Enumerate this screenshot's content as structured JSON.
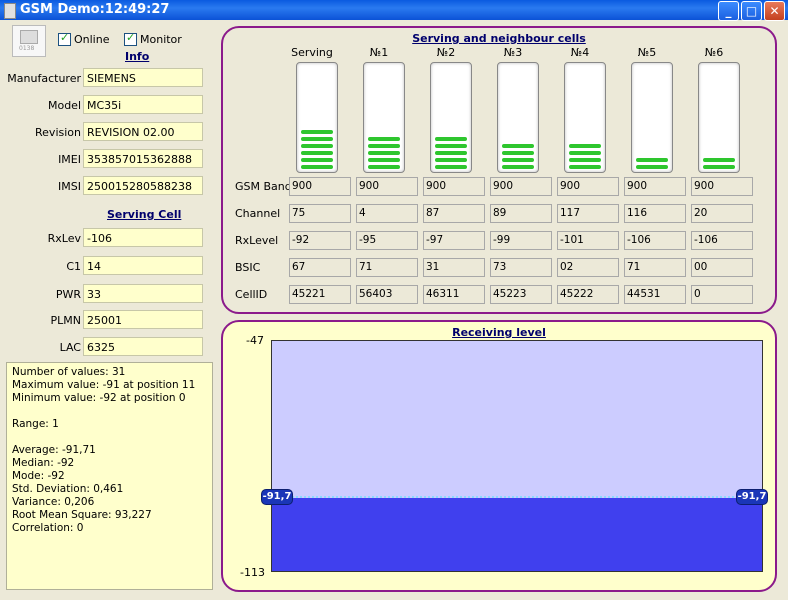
{
  "window": {
    "title": "GSM Demo:12:49:27"
  },
  "toolbar": {
    "online_label": "Online",
    "monitor_label": "Monitor",
    "online_checked": true,
    "monitor_checked": true,
    "app_icon_label": "0138"
  },
  "info": {
    "title": "Info",
    "manufacturer_label": "Manufacturer",
    "manufacturer": "SIEMENS",
    "model_label": "Model",
    "model": "MC35i",
    "revision_label": "Revision",
    "revision": "REVISION 02.00",
    "imei_label": "IMEI",
    "imei": "353857015362888",
    "imsi_label": "IMSI",
    "imsi": "250015280588238"
  },
  "serving_cell": {
    "title": "Serving Cell",
    "rxlev_label": "RxLev",
    "rxlev": "-106",
    "c1_label": "C1",
    "c1": " 14",
    "pwr_label": "PWR",
    "pwr": " 33",
    "plmn_label": "PLMN",
    "plmn": "25001",
    "lac_label": "LAC",
    "lac": "6325"
  },
  "stats": {
    "text": "Number of values: 31\nMaximum value: -91 at position 11\nMinimum value: -92 at position 0\n\nRange: 1\n\nAverage: -91,71\nMedian: -92\nMode: -92\nStd. Deviation: 0,461\nVariance: 0,206\nRoot Mean Square: 93,227\nCorrelation: 0"
  },
  "cells": {
    "title": "Serving and neighbour cells",
    "row_labels": {
      "band": "GSM Band",
      "channel": "Channel",
      "rxlevel": "RxLevel",
      "bsic": "BSIC",
      "cellid": "CellID"
    },
    "columns": [
      {
        "name": "Serving",
        "bars": 6,
        "band": "900",
        "channel": "75",
        "rxlevel": "-92",
        "bsic": "67",
        "cellid": "45221"
      },
      {
        "name": "№1",
        "bars": 5,
        "band": "900",
        "channel": "4",
        "rxlevel": "-95",
        "bsic": "71",
        "cellid": "56403"
      },
      {
        "name": "№2",
        "bars": 5,
        "band": "900",
        "channel": "87",
        "rxlevel": "-97",
        "bsic": "31",
        "cellid": "46311"
      },
      {
        "name": "№3",
        "bars": 4,
        "band": "900",
        "channel": "89",
        "rxlevel": "-99",
        "bsic": "73",
        "cellid": "45223"
      },
      {
        "name": "№4",
        "bars": 4,
        "band": "900",
        "channel": "117",
        "rxlevel": "-101",
        "bsic": "02",
        "cellid": "45222"
      },
      {
        "name": "№5",
        "bars": 2,
        "band": "900",
        "channel": "116",
        "rxlevel": "-106",
        "bsic": "71",
        "cellid": "44531"
      },
      {
        "name": "№6",
        "bars": 2,
        "band": "900",
        "channel": "20",
        "rxlevel": "-106",
        "bsic": "00",
        "cellid": "0"
      }
    ]
  },
  "receiving": {
    "title": "Receiving level",
    "y_max": "-47",
    "y_min": "-113",
    "current_left": "-91,7",
    "current_right": "-91,7"
  },
  "chart_data": {
    "type": "area",
    "title": "Receiving level",
    "ylim": [
      -113,
      -47
    ],
    "series": [
      {
        "values": [
          -92,
          -92,
          -92,
          -92,
          -92,
          -92,
          -92,
          -92,
          -92,
          -92,
          -92,
          -91,
          -91,
          -91,
          -91,
          -91,
          -92,
          -92,
          -92,
          -92,
          -92,
          -91,
          -91,
          -92,
          -92,
          -91,
          -91,
          -91,
          -92,
          -92,
          -92
        ]
      }
    ],
    "average": -91.71,
    "colors": {
      "fill": "#4040ee",
      "background": "#ccccff"
    }
  }
}
